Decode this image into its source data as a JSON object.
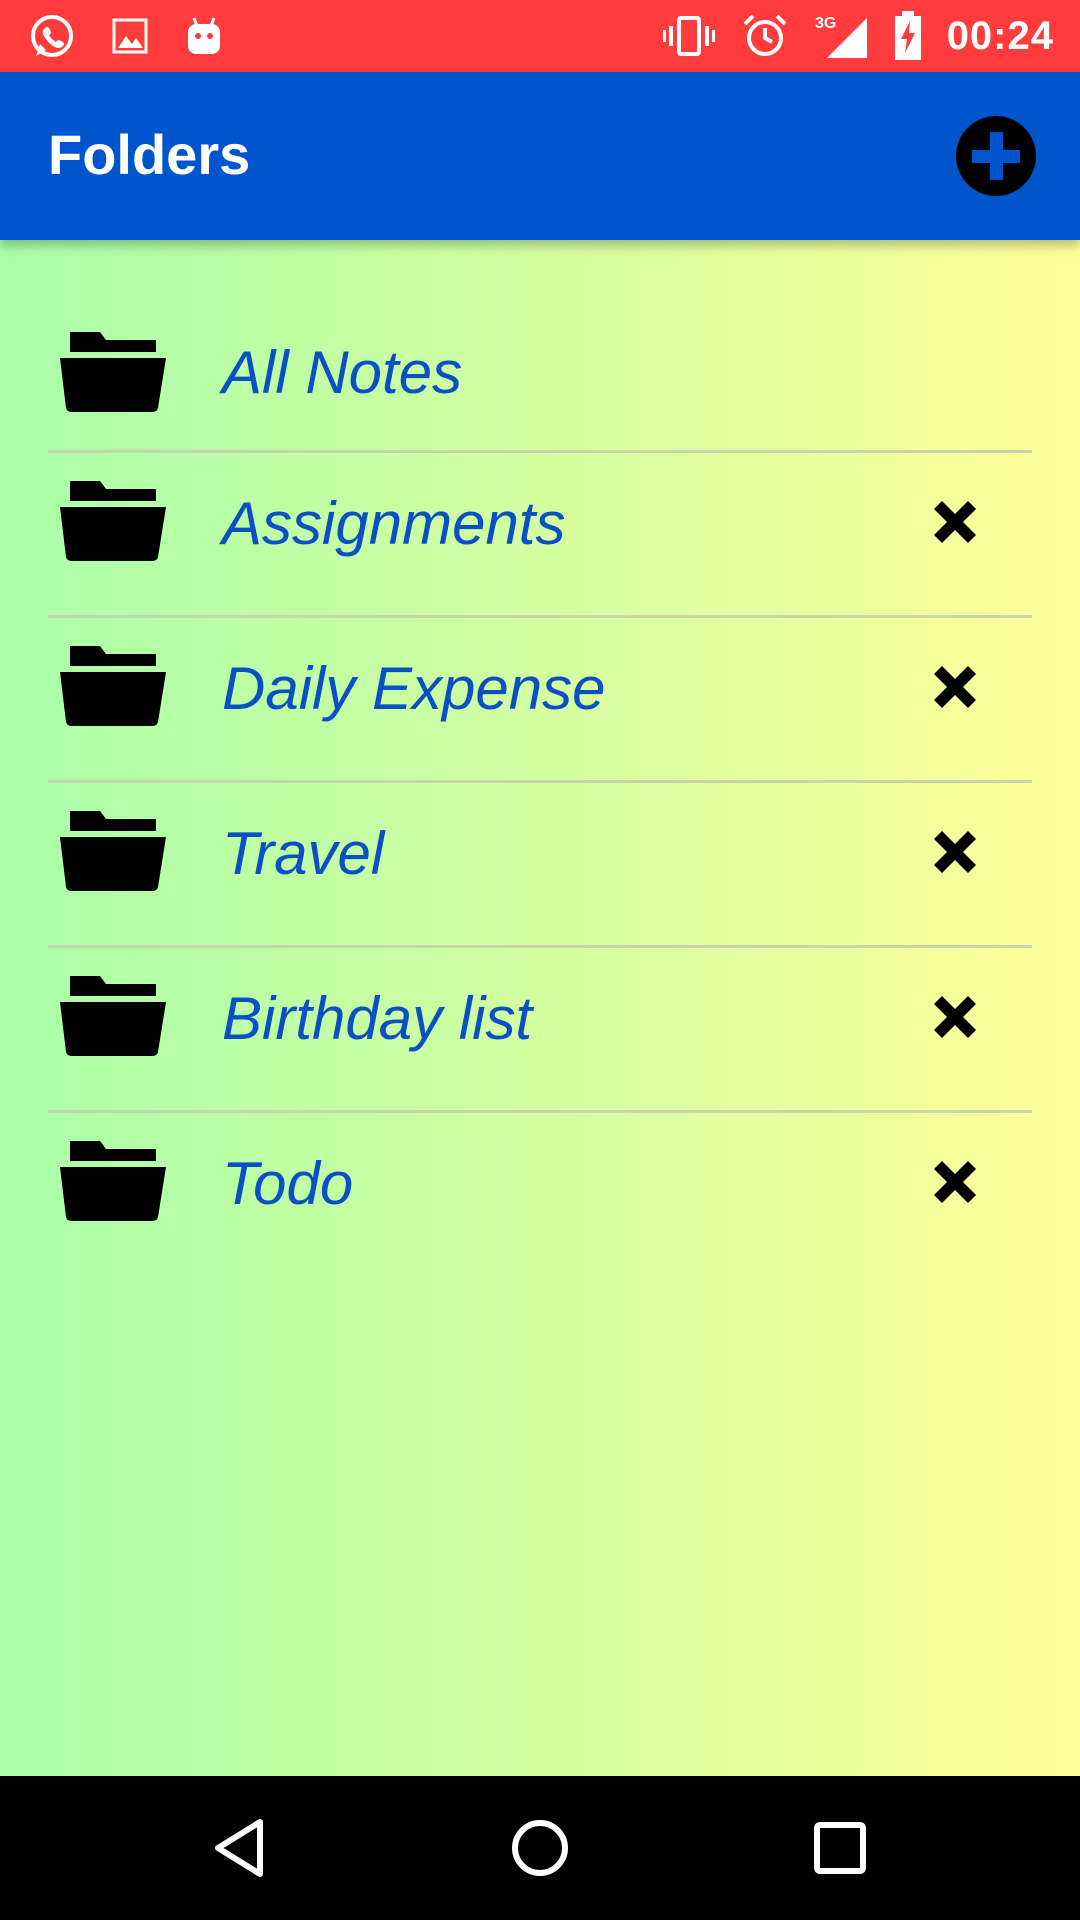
{
  "status_bar": {
    "time": "00:24",
    "left_icons": [
      "whatsapp-icon",
      "image-icon",
      "android-icon"
    ],
    "right_icons": [
      "vibrate-icon",
      "alarm-icon",
      "signal-3g-icon",
      "battery-charging-icon"
    ],
    "background_color": "#ff3b3b"
  },
  "app_bar": {
    "title": "Folders",
    "add_icon": "plus-circle-icon",
    "background_color": "#0055cc"
  },
  "folders": [
    {
      "name": "All Notes",
      "deletable": false
    },
    {
      "name": "Assignments",
      "deletable": true
    },
    {
      "name": "Daily Expense",
      "deletable": true
    },
    {
      "name": "Travel",
      "deletable": true
    },
    {
      "name": "Birthday list",
      "deletable": true
    },
    {
      "name": "Todo",
      "deletable": true
    }
  ],
  "colors": {
    "folder_text": "#0a4fc4",
    "gradient_start": "#a8ffa8",
    "gradient_end": "#ffff99"
  },
  "nav_bar": {
    "buttons": [
      "back-icon",
      "home-icon",
      "recents-icon"
    ]
  }
}
